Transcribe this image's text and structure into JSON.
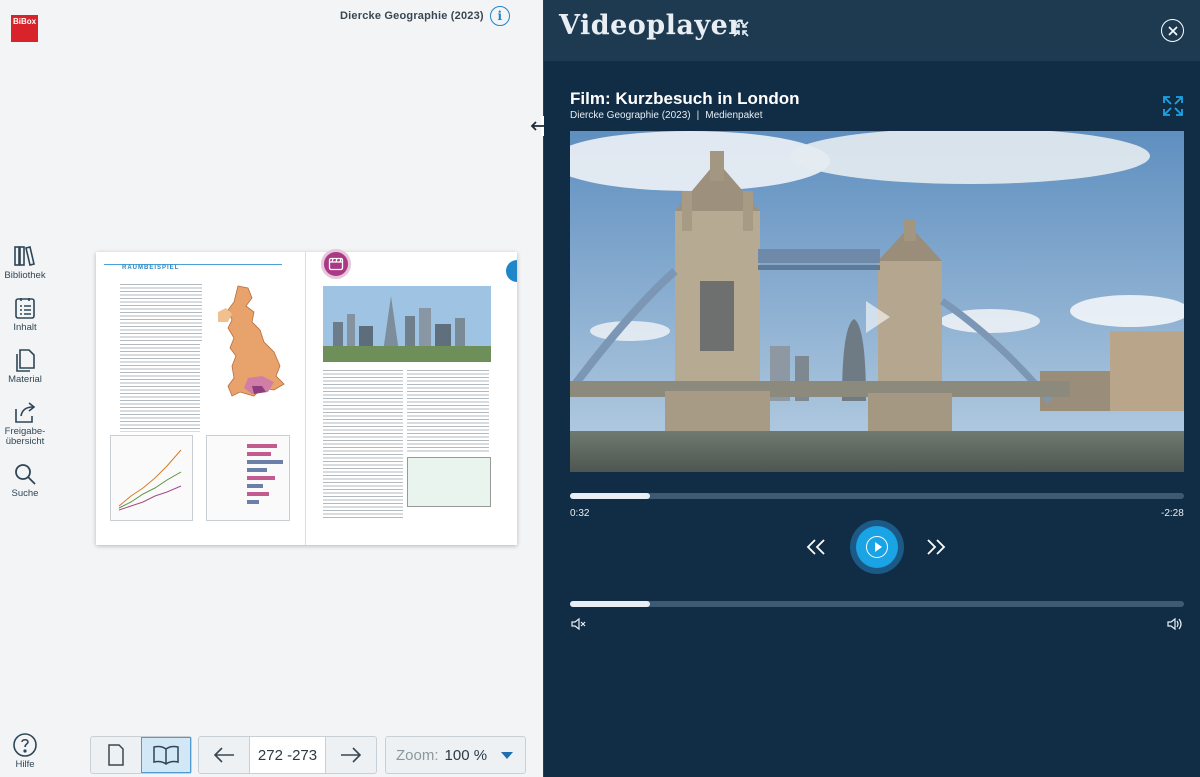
{
  "app": {
    "logo_text": "BiBox",
    "book_title": "Diercke Geographie (2023)",
    "info_icon": "info-icon"
  },
  "sidebar": {
    "items": [
      {
        "label": "Bibliothek",
        "icon": "library-icon"
      },
      {
        "label": "Inhalt",
        "icon": "contents-icon"
      },
      {
        "label": "Material",
        "icon": "material-icon"
      },
      {
        "label": "Freigabe-\nübersicht",
        "icon": "share-icon"
      },
      {
        "label": "Suche",
        "icon": "search-icon"
      }
    ],
    "help": {
      "label": "Hilfe",
      "icon": "help-icon"
    }
  },
  "book": {
    "section_label": "RAUMBEISPIEL"
  },
  "toolbar": {
    "page_range": "272 -273",
    "zoom_label": "Zoom:",
    "zoom_value": "100 %"
  },
  "videoplayer": {
    "title": "Videoplayer",
    "film_title": "Film: Kurzbesuch in London",
    "source": "Diercke Geographie (2023)",
    "separator": "|",
    "package": "Medienpaket",
    "time_current": "0:32",
    "time_remaining": "-2:28",
    "progress_fraction": 0.13,
    "volume_fraction": 0.13,
    "accent_color": "#1aa3e5"
  }
}
